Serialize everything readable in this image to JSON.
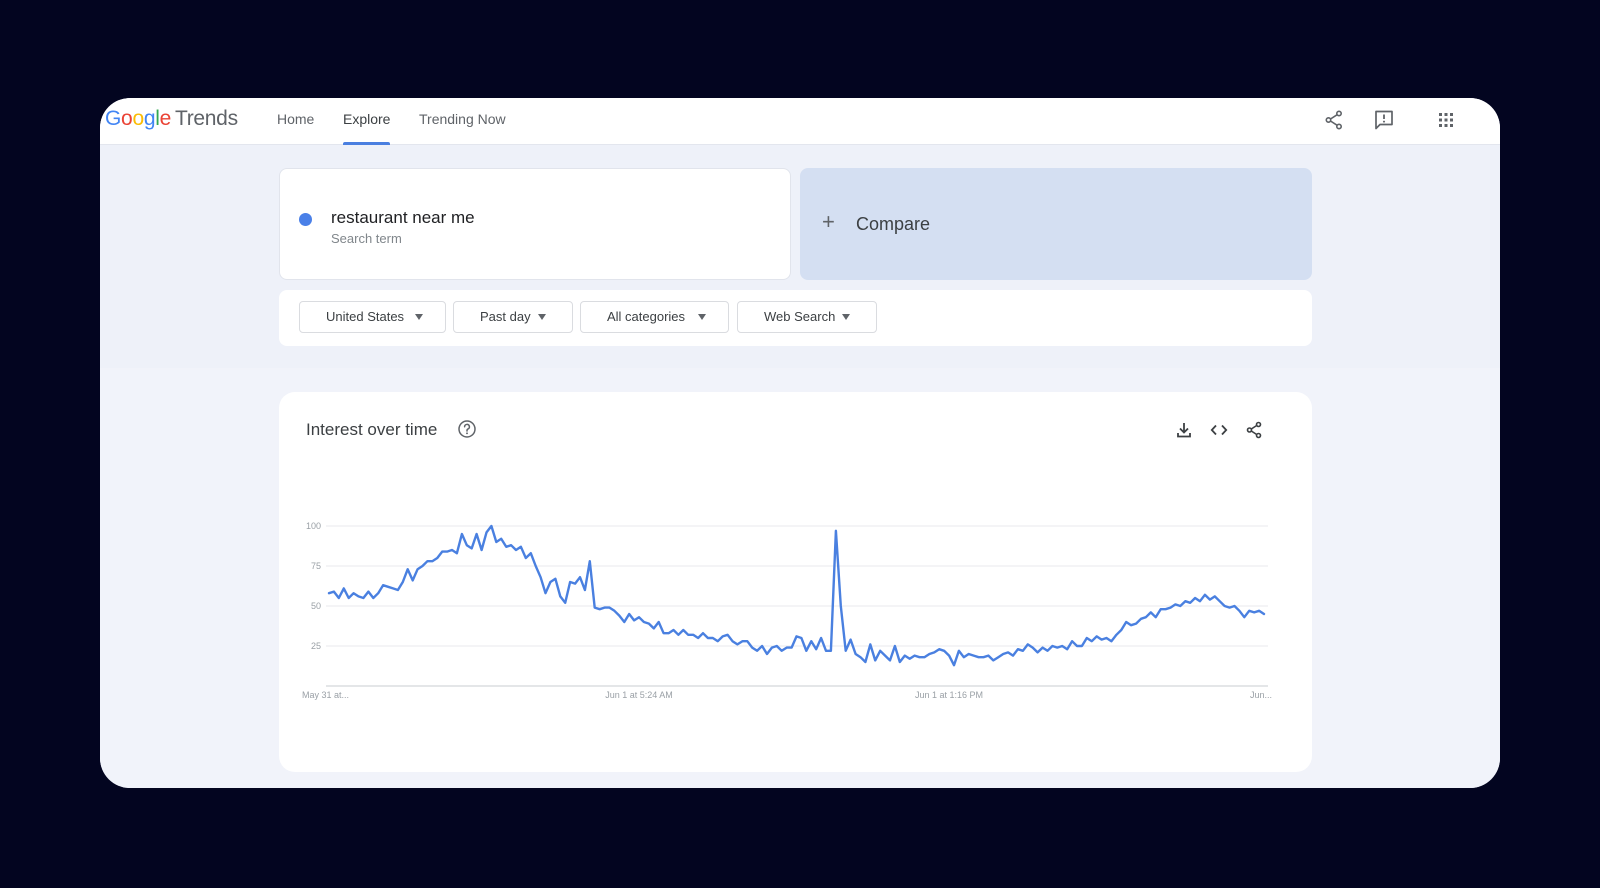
{
  "app": {
    "logo_google": [
      "G",
      "o",
      "o",
      "g",
      "l",
      "e"
    ],
    "logo_product": "Trends"
  },
  "nav": {
    "items": [
      {
        "label": "Home"
      },
      {
        "label": "Explore"
      },
      {
        "label": "Trending Now"
      }
    ],
    "active": "Explore"
  },
  "top_icons": [
    "share-icon",
    "feedback-icon",
    "apps-grid-icon"
  ],
  "search": {
    "term": "restaurant near me",
    "term_type": "Search term",
    "term_color": "#4a80e8"
  },
  "compare": {
    "label": "Compare",
    "icon": "plus-icon"
  },
  "filters": {
    "region": "United States",
    "time": "Past day",
    "category": "All categories",
    "property": "Web Search"
  },
  "chart_panel": {
    "title": "Interest over time",
    "actions": [
      "download-icon",
      "embed-code-icon",
      "share-icon"
    ]
  },
  "chart_data": {
    "type": "line",
    "title": "",
    "xlabel": "",
    "ylabel": "",
    "ylim": [
      0,
      100
    ],
    "yticks": [
      "100",
      "75",
      "50",
      "25"
    ],
    "xtick_labels": [
      "May 31 at...",
      "Jun 1 at 5:24 AM",
      "Jun 1 at 1:16 PM",
      "Jun..."
    ],
    "grid": true,
    "colors": {
      "line": "#4a80e0",
      "grid": "#e8eaed",
      "axis": "#c8ccd2",
      "text": "#9aa0a6"
    },
    "series": [
      {
        "values": [
          58,
          59,
          55,
          61,
          55,
          58,
          56,
          55,
          59,
          55,
          58,
          63,
          62,
          61,
          60,
          65,
          73,
          66,
          73,
          75,
          78,
          78,
          80,
          84,
          84,
          85,
          83,
          95,
          88,
          86,
          95,
          85,
          96,
          100,
          90,
          92,
          87,
          88,
          85,
          87,
          80,
          83,
          75,
          68,
          58,
          65,
          67,
          56,
          52,
          65,
          64,
          68,
          60,
          78,
          49,
          48,
          49,
          49,
          47,
          44,
          40,
          45,
          41,
          43,
          40,
          39,
          36,
          40,
          33,
          33,
          35,
          32,
          35,
          32,
          32,
          30,
          33,
          30,
          30,
          28,
          31,
          32,
          28,
          26,
          28,
          28,
          24,
          22,
          25,
          20,
          24,
          25,
          22,
          24,
          24,
          31,
          30,
          22,
          28,
          23,
          30,
          22,
          22,
          97,
          50,
          22,
          29,
          20,
          18,
          15,
          26,
          16,
          22,
          19,
          16,
          25,
          15,
          19,
          17,
          19,
          18,
          18,
          20,
          21,
          23,
          22,
          19,
          13,
          22,
          18,
          20,
          19,
          18,
          18,
          19,
          16,
          18,
          20,
          21,
          19,
          23,
          22,
          26,
          24,
          21,
          24,
          22,
          25,
          24,
          25,
          23,
          28,
          25,
          25,
          30,
          28,
          31,
          29,
          30,
          28,
          32,
          35,
          40,
          38,
          39,
          42,
          43,
          46,
          43,
          48,
          48,
          49,
          51,
          50,
          53,
          52,
          55,
          53,
          57,
          54,
          56,
          53,
          50,
          49,
          50,
          47,
          43,
          47,
          46,
          47,
          45
        ]
      }
    ]
  }
}
